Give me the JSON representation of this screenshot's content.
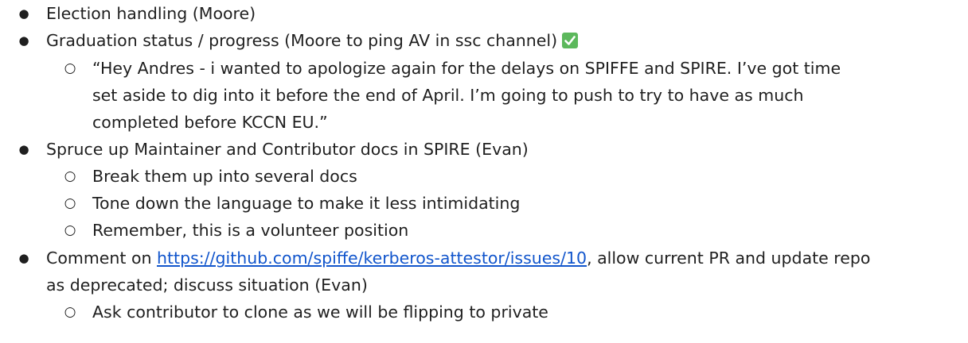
{
  "items": {
    "election": "Election handling (Moore)",
    "graduation": "Graduation status / progress (Moore to ping AV in ssc channel)",
    "quote_line1": "“Hey Andres - i wanted to apologize again for the delays on SPIFFE and SPIRE.  I’ve got time",
    "quote_line2": "set aside to dig into it before the end of April.  I’m going to push to try to have as much",
    "quote_line3": "completed before KCCN EU.”",
    "spruce": "Spruce up Maintainer and Contributor docs in SPIRE (Evan)",
    "break_up": "Break them up into several docs",
    "tone_down": "Tone down the language to make it less intimidating",
    "remember": "Remember, this is a volunteer position",
    "comment_prefix": "Comment on ",
    "comment_link": "https://github.com/spiffe/kerberos-attestor/issues/10",
    "comment_suffix": ", allow current PR and update repo",
    "comment_line2": "as deprecated; discuss situation (Evan)",
    "ask_contributor": "Ask contributor to clone as we will be flipping to private"
  },
  "icons": {
    "bullet_level1": "filled-circle",
    "bullet_level2": "hollow-circle",
    "checkmark": "green-check-box-icon"
  },
  "colors": {
    "text": "#1f1f1f",
    "link": "#1155cc",
    "check": "#5cb85c"
  }
}
